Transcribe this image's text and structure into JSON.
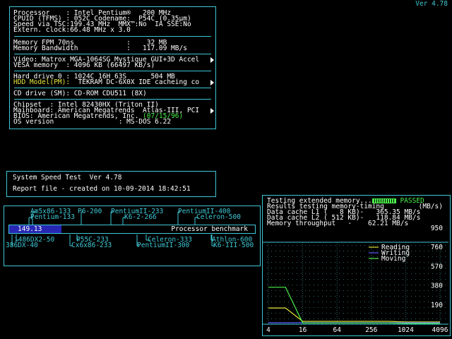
{
  "version": "Ver 4.78",
  "sysinfo": {
    "processor": "Processor    : Intel Pentium®   200 MHz",
    "cpuid": "CPUID (TFMS) : 052C Codename:  P54C (0.35µm)",
    "speed": "Speed via TSC:199.43 MHz  MMX™:No  IA SSE:No",
    "extclock": "Extern. clock:66.48 MHz x 3.0",
    "memory_type": "Memory FPM 70ns             :    32 MB",
    "memory_bw": "Memory Bandwidth            :   117.09 MB/s",
    "video": "Video: Matrox MGA-1064SG Mystique GUI+3D Accel",
    "vesa": "VESA memory  : 4096 KB (66497 KB/s)",
    "hdd0": "Hard drive 0 : 1024C 16H 63S      504 MB",
    "hdd_model_label": "HDD Model(PM):",
    "hdd_model_value": "  TEKRAM DC-6X0X IDE cacheing co",
    "cd": "CD drive (SM): CD-ROM CDU511 (8X)",
    "chipset": "Chipset  : Intel 82430HX (Triton II)",
    "mainboard": "Mainboard: American Megatrends  Atlas-III, PCI",
    "bios_prefix": "BIOS: American Megatrends, Inc. ",
    "bios_date": "07/15/96",
    "os": "OS version                : MS-DOS 6.22"
  },
  "speedtest": {
    "title": "System Speed Test  Ver 4.78",
    "report": "Report file - created on 10-09-2014 18:42:51"
  },
  "benchmark": {
    "top_labels": [
      "Am5x86-133",
      "P6-200",
      "PentiumII-233",
      "PentiumII-400",
      "Pentium-133",
      "K6-2-266",
      "Celeron-500"
    ],
    "bottom_labels": [
      "i486DX2-50",
      "P55C-233",
      "Celeron-333",
      "Athlon-600",
      "386DX-40",
      "Cx6x86-233",
      "PentiumII-300",
      "K6-III-500"
    ],
    "value": "149.13",
    "score": 149.13,
    "max_score": 700,
    "label": "Processor benchmark"
  },
  "memtest": {
    "testing": "Testing extended memory...",
    "status": "PASSED",
    "results": "Results testing memory-timing",
    "unit": "(MB/s)",
    "l1": "Data cache L1 (   8 KB)-   365.35 MB/s",
    "l2": "Data cache L2 ( 512 KB)-   118.84 MB/s",
    "throughput": "Memory throughput   -    62.21 MB/s"
  },
  "chart_data": {
    "type": "line",
    "title": "",
    "xlabel": "",
    "ylabel": "MB/s",
    "x": [
      4,
      8,
      16,
      32,
      64,
      128,
      256,
      512,
      1024,
      2048,
      4096
    ],
    "xticks": [
      "4",
      "16",
      "64",
      "256",
      "1024",
      "4096"
    ],
    "ylim": [
      0,
      950
    ],
    "yticks": [
      "950",
      "760",
      "570",
      "380",
      "190"
    ],
    "series": [
      {
        "name": "Reading",
        "color": "#e4e43a",
        "values": [
          160,
          160,
          28,
          28,
          28,
          28,
          28,
          28,
          22,
          22,
          22
        ]
      },
      {
        "name": "Writing",
        "color": "#5a5aff",
        "values": [
          15,
          15,
          15,
          15,
          15,
          15,
          15,
          15,
          15,
          15,
          15
        ]
      },
      {
        "name": "Moving",
        "color": "#4cf04c",
        "values": [
          365,
          365,
          12,
          12,
          12,
          12,
          12,
          12,
          8,
          8,
          8
        ]
      }
    ],
    "grid": true,
    "legend": "top-right"
  }
}
